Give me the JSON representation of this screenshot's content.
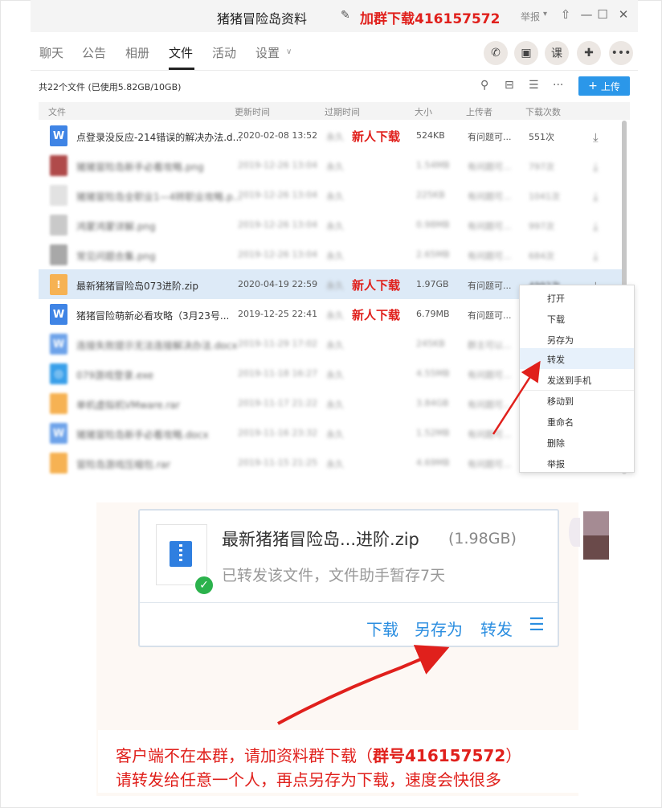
{
  "window": {
    "title": "猪猪冒险岛资料",
    "title_ad": "加群下载416157572",
    "report": "举报",
    "edit_icon": "pencil-icon"
  },
  "tabs": [
    {
      "label": "聊天"
    },
    {
      "label": "公告"
    },
    {
      "label": "相册"
    },
    {
      "label": "文件",
      "active": true
    },
    {
      "label": "活动"
    },
    {
      "label": "设置"
    }
  ],
  "toolbar": {
    "summary": "共22个文件 (已使用5.82GB/10GB)",
    "upload": "上传",
    "upload_icon": "plus-icon"
  },
  "columns": [
    "文件",
    "更新时间",
    "过期时间",
    "大小",
    "上传者",
    "下载次数"
  ],
  "rows": [
    {
      "name": "点登录没反应-214错误的解决办法.d...",
      "time": "2020-02-08 13:52",
      "expire": "永久",
      "badge": "新人下载",
      "size": "524KB",
      "uploader": "有问题可...",
      "downloads": "551次",
      "type": "word"
    },
    {
      "name": "猪猪冒险岛新手必看攻略.png",
      "time": "2019-12-26 13:04",
      "expire": "永久",
      "badge": "",
      "size": "1.54MB",
      "uploader": "有问题可...",
      "downloads": "797次",
      "type": "png"
    },
    {
      "name": "猪猪冒险岛全职业1—4转职业攻略.p...",
      "time": "2019-12-26 13:04",
      "expire": "永久",
      "badge": "",
      "size": "225KB",
      "uploader": "有问题可...",
      "downloads": "1041次",
      "type": "png"
    },
    {
      "name": "鸿蒙鸿蒙详解.png",
      "time": "2019-12-26 13:04",
      "expire": "永久",
      "badge": "",
      "size": "0.98MB",
      "uploader": "有问题可...",
      "downloads": "997次",
      "type": "png"
    },
    {
      "name": "常见问题合集.png",
      "time": "2019-12-26 13:04",
      "expire": "永久",
      "badge": "",
      "size": "2.65MB",
      "uploader": "有问题可...",
      "downloads": "684次",
      "type": "png"
    },
    {
      "name": "最新猪猪冒险岛073进阶.zip",
      "time": "2020-04-19 22:59",
      "expire": "永久",
      "badge": "新人下载",
      "size": "1.97GB",
      "uploader": "有问题可...",
      "downloads": "4992次",
      "type": "zip",
      "selected": true
    },
    {
      "name": "猪猪冒险萌新必看攻略（3月23号...",
      "time": "2019-12-25 22:41",
      "expire": "永久",
      "badge": "新人下载",
      "size": "6.79MB",
      "uploader": "有问题可...",
      "downloads": "",
      "type": "word"
    },
    {
      "name": "连接失败提示无法连接解决办法.docx",
      "time": "2019-11-29 17:02",
      "expire": "永久",
      "badge": "",
      "size": "245KB",
      "uploader": "群主可以...",
      "downloads": "",
      "type": "word"
    },
    {
      "name": "079游戏登录.exe",
      "time": "2019-11-18 16:27",
      "expire": "永久",
      "badge": "",
      "size": "4.55MB",
      "uploader": "有问题可...",
      "downloads": "",
      "type": "exe"
    },
    {
      "name": "单机虚拟机VMware.rar",
      "time": "2019-11-17 21:22",
      "expire": "永久",
      "badge": "",
      "size": "3.84GB",
      "uploader": "有问题可...",
      "downloads": "",
      "type": "zip"
    },
    {
      "name": "猪猪冒险岛新手必看攻略.docx",
      "time": "2019-11-16 23:32",
      "expire": "永久",
      "badge": "",
      "size": "1.52MB",
      "uploader": "有问题可...",
      "downloads": "",
      "type": "word"
    },
    {
      "name": "冒险岛游戏压缩包.rar",
      "time": "2019-11-15 21:25",
      "expire": "永久",
      "badge": "",
      "size": "4.69MB",
      "uploader": "有问题可...",
      "downloads": "",
      "type": "zip"
    }
  ],
  "context_menu": [
    "打开",
    "下载",
    "另存为",
    "转发",
    "发送到手机",
    "移动到",
    "重命名",
    "删除",
    "举报"
  ],
  "forward_card": {
    "name": "最新猪猪冒险岛...进阶.zip",
    "size": "(1.98GB)",
    "status": "已转发该文件，文件助手暂存7天",
    "actions": [
      "下载",
      "另存为",
      "转发"
    ],
    "menu_icon": "hamburger-icon"
  },
  "notice": {
    "line1_prefix": "客户端不在本群，请加资料群下载（",
    "line1_bold": "群号416157572",
    "line1_suffix": "）",
    "line2": "请转发给任意一个人，再点另存为下载，速度会快很多"
  },
  "colors": {
    "accent_red": "#e0201c",
    "accent_blue": "#2b97e9",
    "selected_row": "#ddeaf7"
  }
}
